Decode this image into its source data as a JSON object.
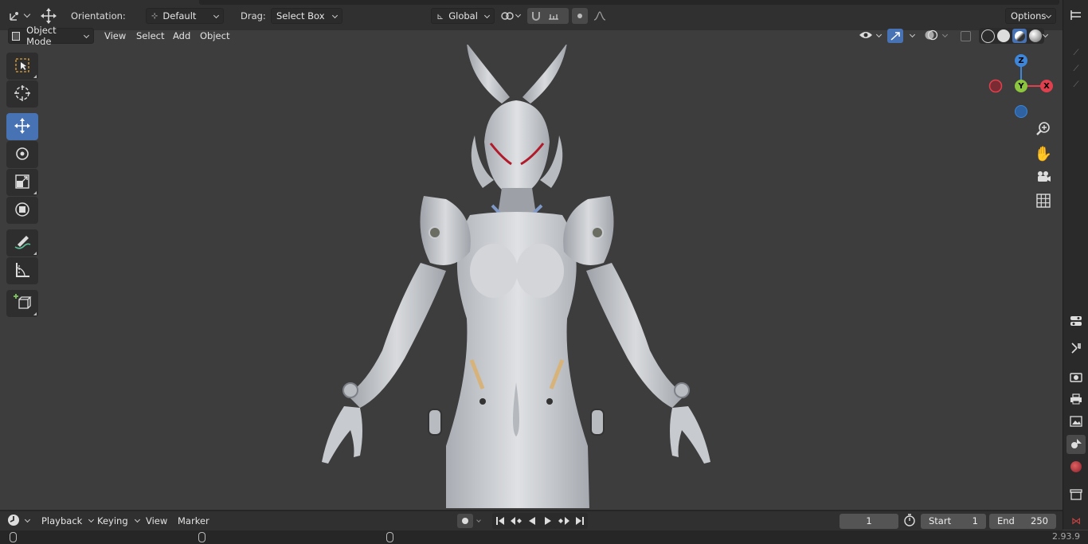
{
  "top_header": {
    "orientation_label": "Orientation:",
    "orientation_value": "Default",
    "drag_label": "Drag:",
    "drag_value": "Select Box",
    "transform_pivot": "Global",
    "options_label": "Options"
  },
  "viewport_header": {
    "mode": "Object Mode",
    "menus": [
      "View",
      "Select",
      "Add",
      "Object"
    ]
  },
  "toolbar": {
    "tools": [
      "select-box-icon",
      "cursor-icon",
      "move-icon",
      "rotate-icon",
      "scale-icon",
      "transform-icon",
      "annotate-icon",
      "measure-icon",
      "add-cube-icon"
    ],
    "active_tool": "move-icon"
  },
  "gizmo": {
    "x_label": "X",
    "y_label": "Y",
    "z_label": "Z",
    "colors": {
      "x": "#e0404e",
      "y": "#8cc63f",
      "z": "#3d86d9"
    }
  },
  "timeline": {
    "menus": [
      "Playback",
      "Keying",
      "View",
      "Marker"
    ],
    "current_frame": "1",
    "start_label": "Start",
    "start_value": "1",
    "end_label": "End",
    "end_value": "250"
  },
  "status": {
    "version": "2.93.9"
  },
  "colors": {
    "accent": "#4772b3",
    "background": "#3d3d3d",
    "header": "#303030"
  }
}
